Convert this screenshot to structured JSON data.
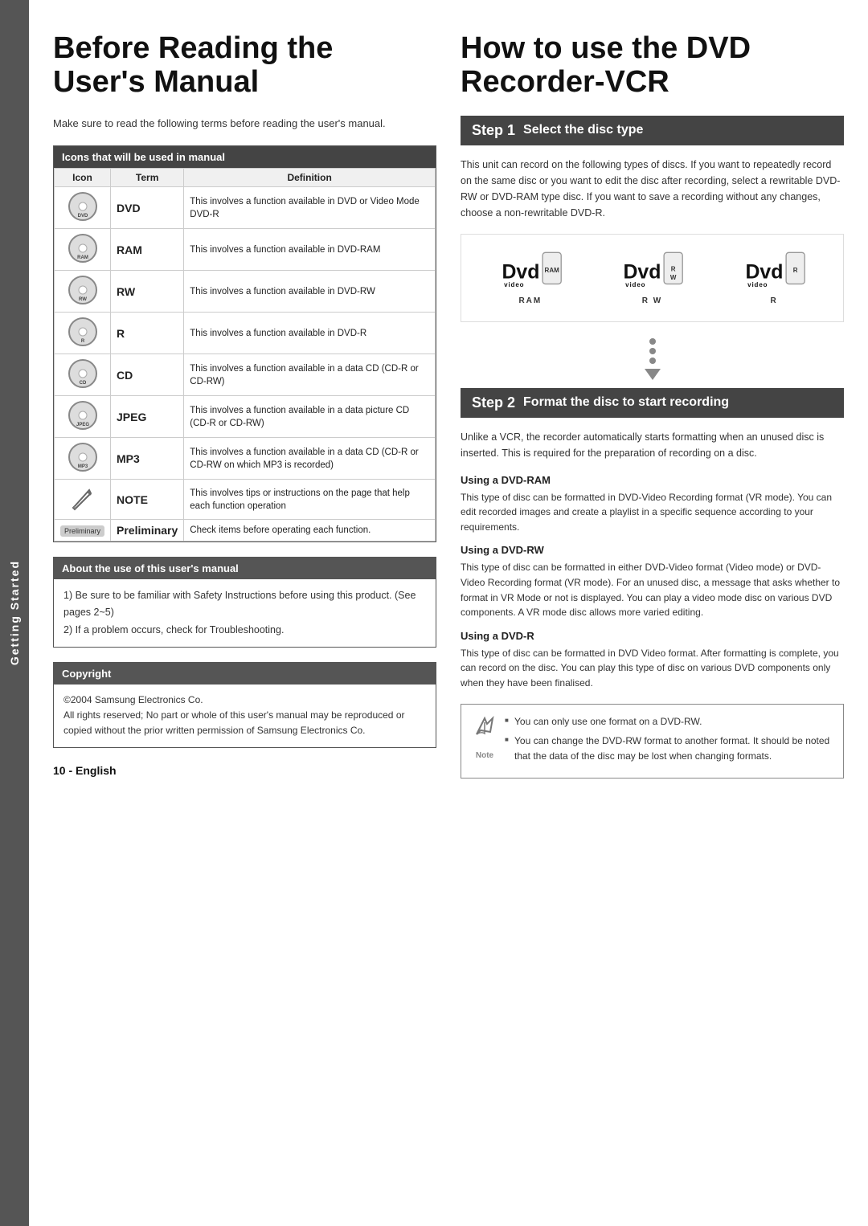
{
  "sidebar": {
    "label": "Getting Started"
  },
  "left": {
    "title_line1": "Before Reading the",
    "title_line2": "User's Manual",
    "intro": "Make sure to read the following terms before reading the user's manual.",
    "icons_table": {
      "header": "Icons that will be used in manual",
      "columns": [
        "Icon",
        "Term",
        "Definition"
      ],
      "rows": [
        {
          "icon_type": "disc",
          "icon_label": "DVD",
          "term": "DVD",
          "definition": "This involves a function available in DVD or Video Mode DVD-R"
        },
        {
          "icon_type": "disc",
          "icon_label": "RAM",
          "term": "RAM",
          "definition": "This involves a function available in DVD-RAM"
        },
        {
          "icon_type": "disc",
          "icon_label": "RW",
          "term": "RW",
          "definition": "This involves a function available in DVD-RW"
        },
        {
          "icon_type": "disc",
          "icon_label": "R",
          "term": "R",
          "definition": "This involves a function available in DVD-R"
        },
        {
          "icon_type": "disc",
          "icon_label": "CD",
          "term": "CD",
          "definition": "This involves a function available in a data CD (CD-R or CD-RW)"
        },
        {
          "icon_type": "disc",
          "icon_label": "JPEG",
          "term": "JPEG",
          "definition": "This involves a function available in a data picture CD (CD-R or CD-RW)"
        },
        {
          "icon_type": "disc",
          "icon_label": "MP3",
          "term": "MP3",
          "definition": "This involves a function available in a data CD (CD-R or CD-RW on which MP3 is recorded)"
        },
        {
          "icon_type": "note",
          "icon_label": "",
          "term": "NOTE",
          "definition": "This involves tips or instructions on the page that help each function operation"
        },
        {
          "icon_type": "preliminary",
          "icon_label": "Preliminary",
          "term": "Preliminary",
          "definition": "Check items before operating each function."
        }
      ]
    },
    "about_box": {
      "header": "About the use of this user's manual",
      "items": [
        "1) Be sure to be familiar with Safety Instructions before using this product. (See pages 2~5)",
        "2) If a problem occurs, check for Troubleshooting."
      ]
    },
    "copyright_box": {
      "header": "Copyright",
      "text": "©2004 Samsung Electronics Co.\nAll rights reserved; No part or whole of this user's manual may be reproduced or copied without the prior written permission of Samsung Electronics Co."
    },
    "page_number": "10  -  English"
  },
  "right": {
    "title_line1": "How to use the DVD",
    "title_line2": "Recorder-VCR",
    "step1": {
      "label": "Step 1",
      "title": "Select the disc type",
      "description": "This unit can record on the following types of discs. If you want to repeatedly record on the same disc or you want to edit the disc after recording, select a rewritable DVD-RW or DVD-RAM type disc. If you want to save a recording without any changes, choose a non-rewritable DVD-R.",
      "logos": [
        {
          "label": "RAM",
          "subtext": "RAM"
        },
        {
          "label": "RW",
          "subtext": "R W"
        },
        {
          "label": "R",
          "subtext": "R"
        }
      ]
    },
    "step2": {
      "label": "Step 2",
      "title": "Format the disc to start recording",
      "intro": "Unlike a VCR, the recorder automatically starts formatting when an unused disc is inserted. This is required for the preparation of recording on a disc.",
      "sections": [
        {
          "title": "Using a DVD-RAM",
          "text": "This type of disc can be formatted in DVD-Video Recording format (VR mode). You can edit recorded images and create a playlist in a specific sequence according to your requirements."
        },
        {
          "title": "Using a DVD-RW",
          "text": "This type of disc can be formatted in either DVD-Video format (Video mode) or DVD-Video Recording format (VR mode). For an unused disc, a message that asks whether to format in VR Mode or not is displayed. You can play a video mode disc on various DVD components. A VR mode disc allows more varied editing."
        },
        {
          "title": "Using a DVD-R",
          "text": "This type of disc can be formatted in DVD Video format. After formatting is complete, you can record on the disc. You can play this type of disc on various DVD components only when they have been finalised."
        }
      ],
      "note_items": [
        "You can only use one format on a DVD-RW.",
        "You can change the DVD-RW format to another format. It should be noted that the data of the disc may be lost when changing formats."
      ]
    }
  }
}
